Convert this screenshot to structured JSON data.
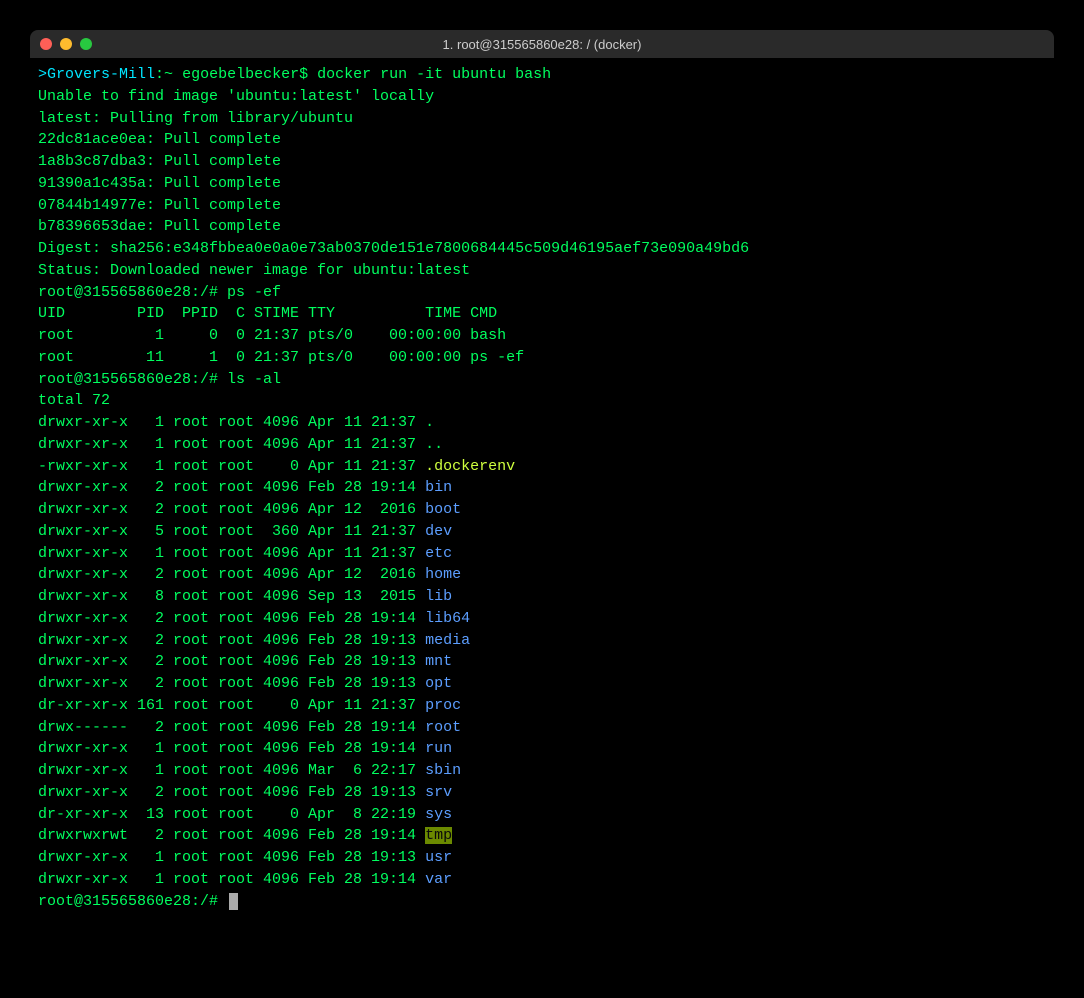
{
  "window": {
    "title": "1. root@315565860e28: / (docker)"
  },
  "prompt1": {
    "arrow": ">",
    "host": "Grovers-Mill",
    "sep": ":~ ",
    "user": "egoebelbecker",
    "dollar": "$ ",
    "cmd": "docker run -it ubuntu bash"
  },
  "pull": {
    "l1": "Unable to find image 'ubuntu:latest' locally",
    "l2": "latest: Pulling from library/ubuntu",
    "l3": "22dc81ace0ea: Pull complete",
    "l4": "1a8b3c87dba3: Pull complete",
    "l5": "91390a1c435a: Pull complete",
    "l6": "07844b14977e: Pull complete",
    "l7": "b78396653dae: Pull complete",
    "l8": "Digest: sha256:e348fbbea0e0a0e73ab0370de151e7800684445c509d46195aef73e090a49bd6",
    "l9": "Status: Downloaded newer image for ubuntu:latest"
  },
  "prompt2": {
    "text": "root@315565860e28:/# ",
    "cmd": "ps -ef"
  },
  "ps": {
    "header": "UID        PID  PPID  C STIME TTY          TIME CMD",
    "r1": "root         1     0  0 21:37 pts/0    00:00:00 bash",
    "r2": "root        11     1  0 21:37 pts/0    00:00:00 ps -ef"
  },
  "prompt3": {
    "text": "root@315565860e28:/# ",
    "cmd": "ls -al"
  },
  "ls": {
    "total": "total 72",
    "entries": [
      {
        "attrs": "drwxr-xr-x   1 root root 4096 Apr 11 21:37 ",
        "name": ".",
        "class": "green"
      },
      {
        "attrs": "drwxr-xr-x   1 root root 4096 Apr 11 21:37 ",
        "name": "..",
        "class": "green"
      },
      {
        "attrs": "-rwxr-xr-x   1 root root    0 Apr 11 21:37 ",
        "name": ".dockerenv",
        "class": "yellow"
      },
      {
        "attrs": "drwxr-xr-x   2 root root 4096 Feb 28 19:14 ",
        "name": "bin",
        "class": "blue"
      },
      {
        "attrs": "drwxr-xr-x   2 root root 4096 Apr 12  2016 ",
        "name": "boot",
        "class": "blue"
      },
      {
        "attrs": "drwxr-xr-x   5 root root  360 Apr 11 21:37 ",
        "name": "dev",
        "class": "blue"
      },
      {
        "attrs": "drwxr-xr-x   1 root root 4096 Apr 11 21:37 ",
        "name": "etc",
        "class": "blue"
      },
      {
        "attrs": "drwxr-xr-x   2 root root 4096 Apr 12  2016 ",
        "name": "home",
        "class": "blue"
      },
      {
        "attrs": "drwxr-xr-x   8 root root 4096 Sep 13  2015 ",
        "name": "lib",
        "class": "blue"
      },
      {
        "attrs": "drwxr-xr-x   2 root root 4096 Feb 28 19:14 ",
        "name": "lib64",
        "class": "blue"
      },
      {
        "attrs": "drwxr-xr-x   2 root root 4096 Feb 28 19:13 ",
        "name": "media",
        "class": "blue"
      },
      {
        "attrs": "drwxr-xr-x   2 root root 4096 Feb 28 19:13 ",
        "name": "mnt",
        "class": "blue"
      },
      {
        "attrs": "drwxr-xr-x   2 root root 4096 Feb 28 19:13 ",
        "name": "opt",
        "class": "blue"
      },
      {
        "attrs": "dr-xr-xr-x 161 root root    0 Apr 11 21:37 ",
        "name": "proc",
        "class": "blue"
      },
      {
        "attrs": "drwx------   2 root root 4096 Feb 28 19:14 ",
        "name": "root",
        "class": "blue"
      },
      {
        "attrs": "drwxr-xr-x   1 root root 4096 Feb 28 19:14 ",
        "name": "run",
        "class": "blue"
      },
      {
        "attrs": "drwxr-xr-x   1 root root 4096 Mar  6 22:17 ",
        "name": "sbin",
        "class": "blue"
      },
      {
        "attrs": "drwxr-xr-x   2 root root 4096 Feb 28 19:13 ",
        "name": "srv",
        "class": "blue"
      },
      {
        "attrs": "dr-xr-xr-x  13 root root    0 Apr  8 22:19 ",
        "name": "sys",
        "class": "blue"
      },
      {
        "attrs": "drwxrwxrwt   2 root root 4096 Feb 28 19:14 ",
        "name": "tmp",
        "class": "sticky-bg"
      },
      {
        "attrs": "drwxr-xr-x   1 root root 4096 Feb 28 19:13 ",
        "name": "usr",
        "class": "blue"
      },
      {
        "attrs": "drwxr-xr-x   1 root root 4096 Feb 28 19:14 ",
        "name": "var",
        "class": "blue"
      }
    ]
  },
  "prompt4": {
    "text": "root@315565860e28:/#"
  }
}
